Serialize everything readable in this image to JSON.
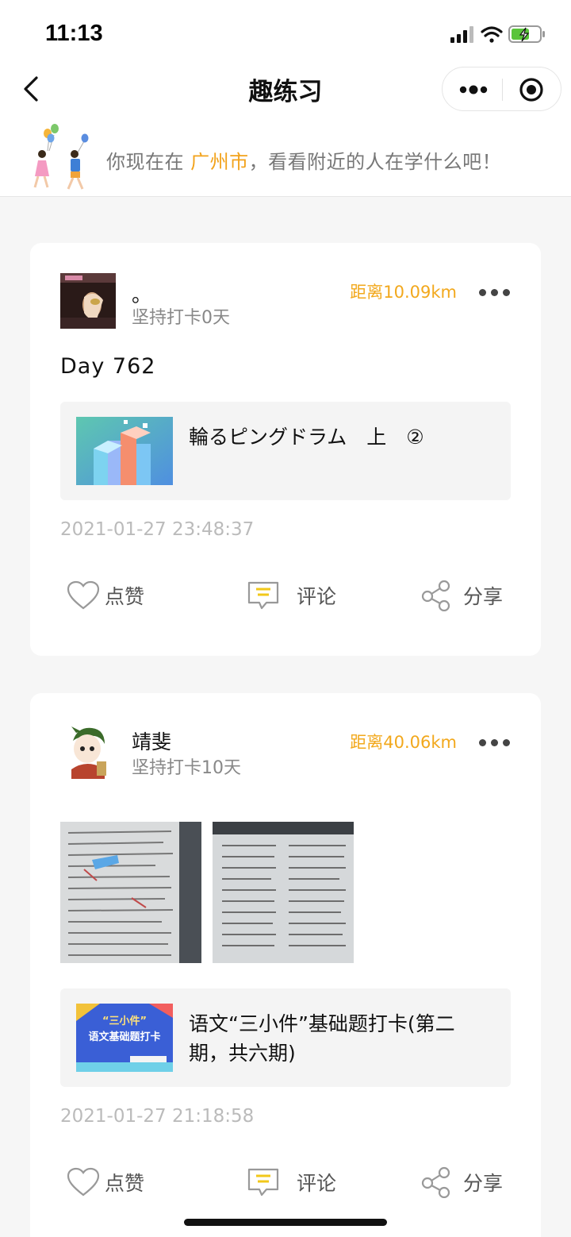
{
  "status_bar": {
    "time": "11:13"
  },
  "nav": {
    "title": "趣练习"
  },
  "banner": {
    "prefix": "你现在在",
    "city": "广州市",
    "suffix": "，看看附近的人在学什么吧！"
  },
  "posts": [
    {
      "username": "。",
      "streak": "坚持打卡0天",
      "distance": "距离10.09km",
      "text": "Day  762",
      "course": "輪るピングドラム　上　②",
      "timestamp": "2021-01-27 23:48:37",
      "like_label": "点赞",
      "comment_label": "评论",
      "share_label": "分享"
    },
    {
      "username": "靖斐",
      "streak": "坚持打卡10天",
      "distance": "距离40.06km",
      "course": "语文“三小件”基础题打卡(第二期，共六期)",
      "course_thumb_text": "“三小件” 语文基础题打卡",
      "timestamp": "2021-01-27 21:18:58",
      "like_label": "点赞",
      "comment_label": "评论",
      "share_label": "分享"
    }
  ],
  "colors": {
    "accent": "#f2a21a",
    "distance": "#f2a81c"
  }
}
